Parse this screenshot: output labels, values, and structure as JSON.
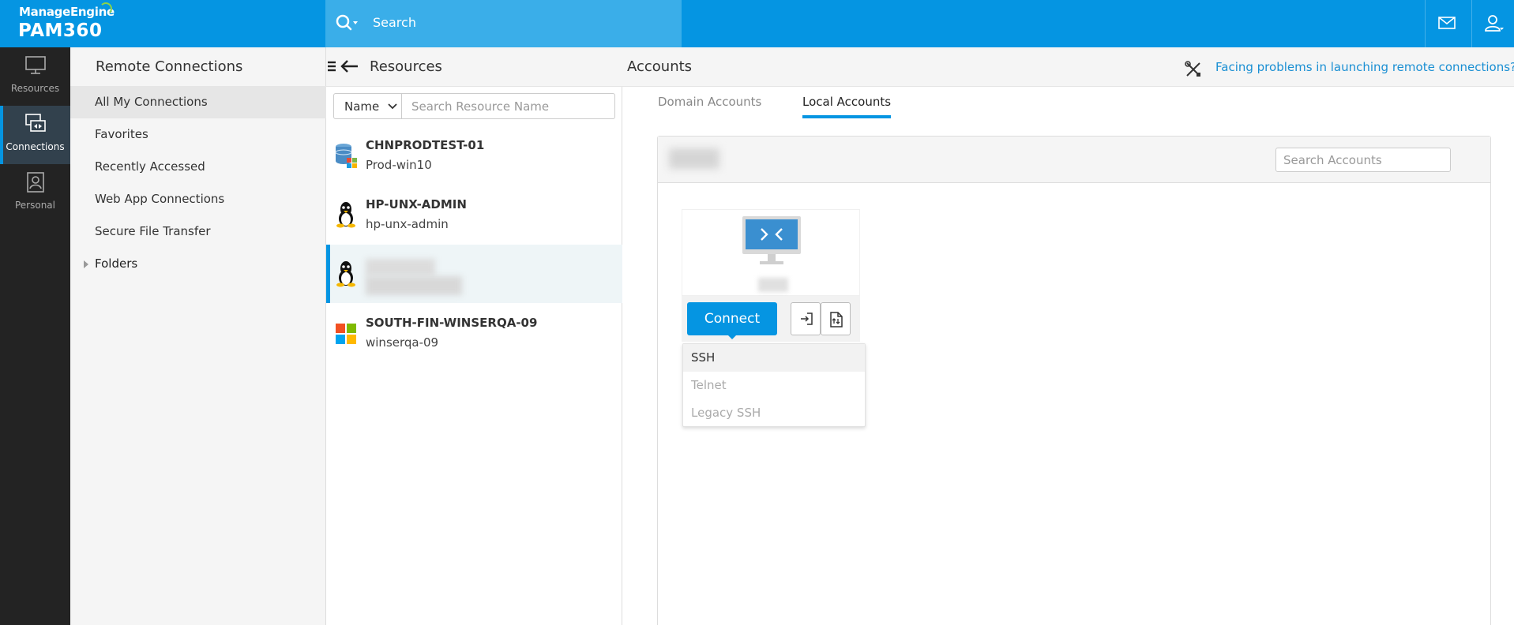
{
  "brand": {
    "company": "ManageEngine",
    "product": "PAM360"
  },
  "topbar": {
    "search_placeholder": "Search"
  },
  "rail": {
    "items": [
      {
        "label": "Resources",
        "icon": "monitor-icon"
      },
      {
        "label": "Connections",
        "icon": "connections-icon",
        "active": true
      },
      {
        "label": "Personal",
        "icon": "personal-icon"
      }
    ]
  },
  "remote_connections": {
    "title": "Remote Connections",
    "items": [
      {
        "label": "All My Connections",
        "selected": true
      },
      {
        "label": "Favorites"
      },
      {
        "label": "Recently Accessed"
      },
      {
        "label": "Web App Connections"
      },
      {
        "label": "Secure File Transfer"
      },
      {
        "label": "Folders"
      }
    ]
  },
  "resources": {
    "title": "Resources",
    "filter_selected": "Name",
    "search_placeholder": "Search Resource Name",
    "rows": [
      {
        "name": "CHNPRODTEST-01",
        "sub": "Prod-win10",
        "icon": "database-icon"
      },
      {
        "name": "HP-UNX-ADMIN",
        "sub": "hp-unx-admin",
        "icon": "linux-icon"
      },
      {
        "name": "",
        "sub": "",
        "icon": "linux-icon",
        "selected": true
      },
      {
        "name": "SOUTH-FIN-WINSERQA-09",
        "sub": "winserqa-09",
        "icon": "windows-icon"
      }
    ]
  },
  "accounts": {
    "title": "Accounts",
    "help_link": "Facing problems in launching remote connections?",
    "tabs": [
      {
        "label": "Domain Accounts",
        "active": false
      },
      {
        "label": "Local Accounts",
        "active": true
      }
    ],
    "search_placeholder": "Search Accounts",
    "connect_label": "Connect",
    "protocols": [
      {
        "label": "SSH",
        "highlighted": true
      },
      {
        "label": "Telnet"
      },
      {
        "label": "Legacy SSH"
      }
    ]
  },
  "colors": {
    "accent": "#0595e2",
    "rail": "#232323",
    "search_bg": "#3aaee9"
  }
}
